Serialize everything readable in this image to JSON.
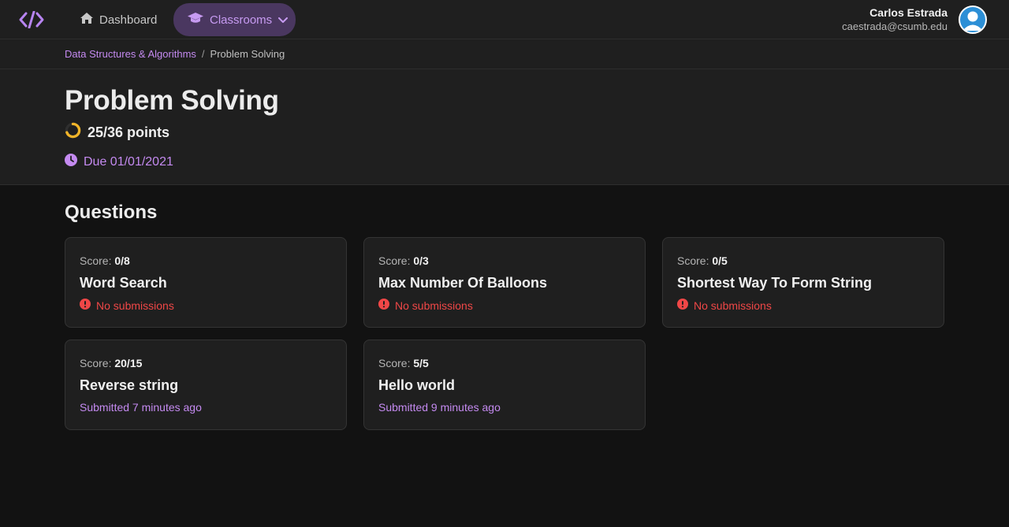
{
  "nav": {
    "dashboard_label": "Dashboard",
    "classrooms_label": "Classrooms"
  },
  "user": {
    "name": "Carlos Estrada",
    "email": "caestrada@csumb.edu"
  },
  "breadcrumb": {
    "parent": "Data Structures & Algorithms",
    "separator": "/",
    "current": "Problem Solving"
  },
  "assignment": {
    "title": "Problem Solving",
    "points": "25/36 points",
    "progress_fraction": 0.694,
    "due": "Due 01/01/2021"
  },
  "questions": {
    "heading": "Questions",
    "score_label": "Score:",
    "items": [
      {
        "score": "0/8",
        "title": "Word Search",
        "status": "No submissions",
        "status_type": "error"
      },
      {
        "score": "0/3",
        "title": "Max Number Of Balloons",
        "status": "No submissions",
        "status_type": "error"
      },
      {
        "score": "0/5",
        "title": "Shortest Way To Form String",
        "status": "No submissions",
        "status_type": "error"
      },
      {
        "score": "20/15",
        "title": "Reverse string",
        "status": "Submitted 7 minutes ago",
        "status_type": "ok"
      },
      {
        "score": "5/5",
        "title": "Hello world",
        "status": "Submitted 9 minutes ago",
        "status_type": "ok"
      }
    ]
  },
  "colors": {
    "accent": "#c48af0",
    "error": "#f04747",
    "progress": "#f0b429",
    "background": "#121212",
    "surface": "#1f1f1f"
  }
}
